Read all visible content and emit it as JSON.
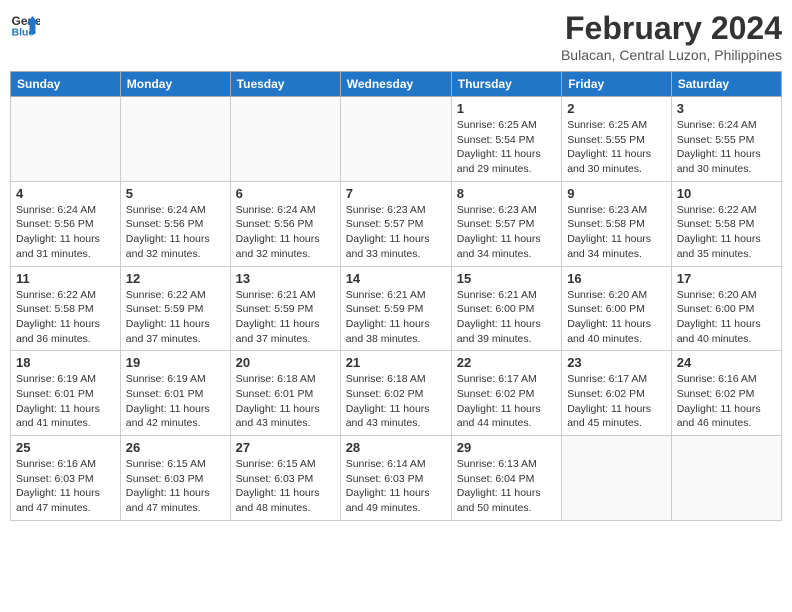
{
  "header": {
    "logo_line1": "General",
    "logo_line2": "Blue",
    "month_year": "February 2024",
    "location": "Bulacan, Central Luzon, Philippines"
  },
  "weekdays": [
    "Sunday",
    "Monday",
    "Tuesday",
    "Wednesday",
    "Thursday",
    "Friday",
    "Saturday"
  ],
  "weeks": [
    [
      {
        "day": "",
        "sunrise": "",
        "sunset": "",
        "daylight": ""
      },
      {
        "day": "",
        "sunrise": "",
        "sunset": "",
        "daylight": ""
      },
      {
        "day": "",
        "sunrise": "",
        "sunset": "",
        "daylight": ""
      },
      {
        "day": "",
        "sunrise": "",
        "sunset": "",
        "daylight": ""
      },
      {
        "day": "1",
        "sunrise": "Sunrise: 6:25 AM",
        "sunset": "Sunset: 5:54 PM",
        "daylight": "Daylight: 11 hours and 29 minutes."
      },
      {
        "day": "2",
        "sunrise": "Sunrise: 6:25 AM",
        "sunset": "Sunset: 5:55 PM",
        "daylight": "Daylight: 11 hours and 30 minutes."
      },
      {
        "day": "3",
        "sunrise": "Sunrise: 6:24 AM",
        "sunset": "Sunset: 5:55 PM",
        "daylight": "Daylight: 11 hours and 30 minutes."
      }
    ],
    [
      {
        "day": "4",
        "sunrise": "Sunrise: 6:24 AM",
        "sunset": "Sunset: 5:56 PM",
        "daylight": "Daylight: 11 hours and 31 minutes."
      },
      {
        "day": "5",
        "sunrise": "Sunrise: 6:24 AM",
        "sunset": "Sunset: 5:56 PM",
        "daylight": "Daylight: 11 hours and 32 minutes."
      },
      {
        "day": "6",
        "sunrise": "Sunrise: 6:24 AM",
        "sunset": "Sunset: 5:56 PM",
        "daylight": "Daylight: 11 hours and 32 minutes."
      },
      {
        "day": "7",
        "sunrise": "Sunrise: 6:23 AM",
        "sunset": "Sunset: 5:57 PM",
        "daylight": "Daylight: 11 hours and 33 minutes."
      },
      {
        "day": "8",
        "sunrise": "Sunrise: 6:23 AM",
        "sunset": "Sunset: 5:57 PM",
        "daylight": "Daylight: 11 hours and 34 minutes."
      },
      {
        "day": "9",
        "sunrise": "Sunrise: 6:23 AM",
        "sunset": "Sunset: 5:58 PM",
        "daylight": "Daylight: 11 hours and 34 minutes."
      },
      {
        "day": "10",
        "sunrise": "Sunrise: 6:22 AM",
        "sunset": "Sunset: 5:58 PM",
        "daylight": "Daylight: 11 hours and 35 minutes."
      }
    ],
    [
      {
        "day": "11",
        "sunrise": "Sunrise: 6:22 AM",
        "sunset": "Sunset: 5:58 PM",
        "daylight": "Daylight: 11 hours and 36 minutes."
      },
      {
        "day": "12",
        "sunrise": "Sunrise: 6:22 AM",
        "sunset": "Sunset: 5:59 PM",
        "daylight": "Daylight: 11 hours and 37 minutes."
      },
      {
        "day": "13",
        "sunrise": "Sunrise: 6:21 AM",
        "sunset": "Sunset: 5:59 PM",
        "daylight": "Daylight: 11 hours and 37 minutes."
      },
      {
        "day": "14",
        "sunrise": "Sunrise: 6:21 AM",
        "sunset": "Sunset: 5:59 PM",
        "daylight": "Daylight: 11 hours and 38 minutes."
      },
      {
        "day": "15",
        "sunrise": "Sunrise: 6:21 AM",
        "sunset": "Sunset: 6:00 PM",
        "daylight": "Daylight: 11 hours and 39 minutes."
      },
      {
        "day": "16",
        "sunrise": "Sunrise: 6:20 AM",
        "sunset": "Sunset: 6:00 PM",
        "daylight": "Daylight: 11 hours and 40 minutes."
      },
      {
        "day": "17",
        "sunrise": "Sunrise: 6:20 AM",
        "sunset": "Sunset: 6:00 PM",
        "daylight": "Daylight: 11 hours and 40 minutes."
      }
    ],
    [
      {
        "day": "18",
        "sunrise": "Sunrise: 6:19 AM",
        "sunset": "Sunset: 6:01 PM",
        "daylight": "Daylight: 11 hours and 41 minutes."
      },
      {
        "day": "19",
        "sunrise": "Sunrise: 6:19 AM",
        "sunset": "Sunset: 6:01 PM",
        "daylight": "Daylight: 11 hours and 42 minutes."
      },
      {
        "day": "20",
        "sunrise": "Sunrise: 6:18 AM",
        "sunset": "Sunset: 6:01 PM",
        "daylight": "Daylight: 11 hours and 43 minutes."
      },
      {
        "day": "21",
        "sunrise": "Sunrise: 6:18 AM",
        "sunset": "Sunset: 6:02 PM",
        "daylight": "Daylight: 11 hours and 43 minutes."
      },
      {
        "day": "22",
        "sunrise": "Sunrise: 6:17 AM",
        "sunset": "Sunset: 6:02 PM",
        "daylight": "Daylight: 11 hours and 44 minutes."
      },
      {
        "day": "23",
        "sunrise": "Sunrise: 6:17 AM",
        "sunset": "Sunset: 6:02 PM",
        "daylight": "Daylight: 11 hours and 45 minutes."
      },
      {
        "day": "24",
        "sunrise": "Sunrise: 6:16 AM",
        "sunset": "Sunset: 6:02 PM",
        "daylight": "Daylight: 11 hours and 46 minutes."
      }
    ],
    [
      {
        "day": "25",
        "sunrise": "Sunrise: 6:16 AM",
        "sunset": "Sunset: 6:03 PM",
        "daylight": "Daylight: 11 hours and 47 minutes."
      },
      {
        "day": "26",
        "sunrise": "Sunrise: 6:15 AM",
        "sunset": "Sunset: 6:03 PM",
        "daylight": "Daylight: 11 hours and 47 minutes."
      },
      {
        "day": "27",
        "sunrise": "Sunrise: 6:15 AM",
        "sunset": "Sunset: 6:03 PM",
        "daylight": "Daylight: 11 hours and 48 minutes."
      },
      {
        "day": "28",
        "sunrise": "Sunrise: 6:14 AM",
        "sunset": "Sunset: 6:03 PM",
        "daylight": "Daylight: 11 hours and 49 minutes."
      },
      {
        "day": "29",
        "sunrise": "Sunrise: 6:13 AM",
        "sunset": "Sunset: 6:04 PM",
        "daylight": "Daylight: 11 hours and 50 minutes."
      },
      {
        "day": "",
        "sunrise": "",
        "sunset": "",
        "daylight": ""
      },
      {
        "day": "",
        "sunrise": "",
        "sunset": "",
        "daylight": ""
      }
    ]
  ]
}
